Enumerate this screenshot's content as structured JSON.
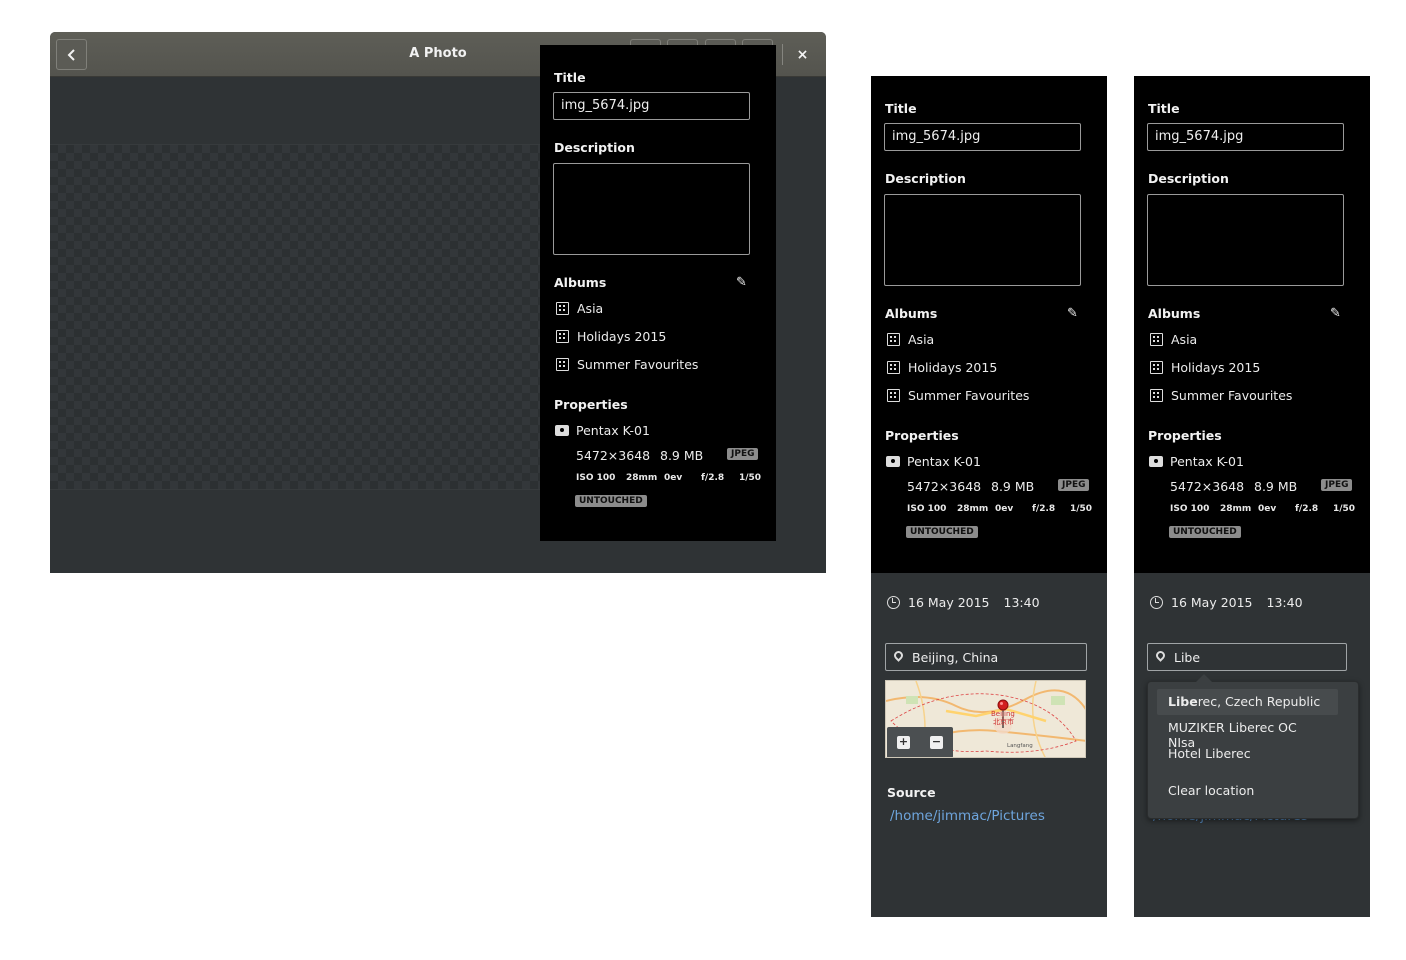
{
  "window": {
    "title": "A Photo",
    "close_glyph": "×",
    "back_glyph": "‹"
  },
  "headerbar_icons": [
    "back-icon",
    "share-icon",
    "menu-icon",
    "close-icon"
  ],
  "properties": {
    "title_label": "Title",
    "title_value": "img_5674.jpg",
    "description_label": "Description",
    "description_value": "",
    "albums_label": "Albums",
    "albums": [
      "Asia",
      "Holidays 2015",
      "Summer Favourites"
    ],
    "properties_label": "Properties",
    "camera": "Pentax K-01",
    "dimensions": "5472×3648",
    "file_size": "8.9 MB",
    "format_badge": "JPEG",
    "iso": "ISO 100",
    "focal_length": "28mm",
    "exposure_comp": "0ev",
    "aperture": "f/2.8",
    "shutter": "1/50",
    "state_badge": "UNTOUCHED"
  },
  "details": {
    "date": "16 May 2015",
    "time": "13:40",
    "location_value": "Beijing, China",
    "location_query": "Libe",
    "map_label_en": "Beijing",
    "map_label_zh": "北京市",
    "map_label_2": "Langfang",
    "source_label": "Source",
    "source_path": "/home/jimmac/Pictures"
  },
  "location_popover": {
    "first_match_bold": "Libe",
    "first_match_rest": "rec, Czech Republic",
    "items": [
      "MUZIKER Liberec OC NIsa",
      "Hotel Liberec"
    ],
    "clear_label": "Clear location"
  },
  "colors": {
    "panel_black": "#000000",
    "panel_grey": "#2f3335",
    "headerbar": "#5a5a54",
    "link": "#6ea5dd",
    "badge": "#8c8c8c"
  }
}
